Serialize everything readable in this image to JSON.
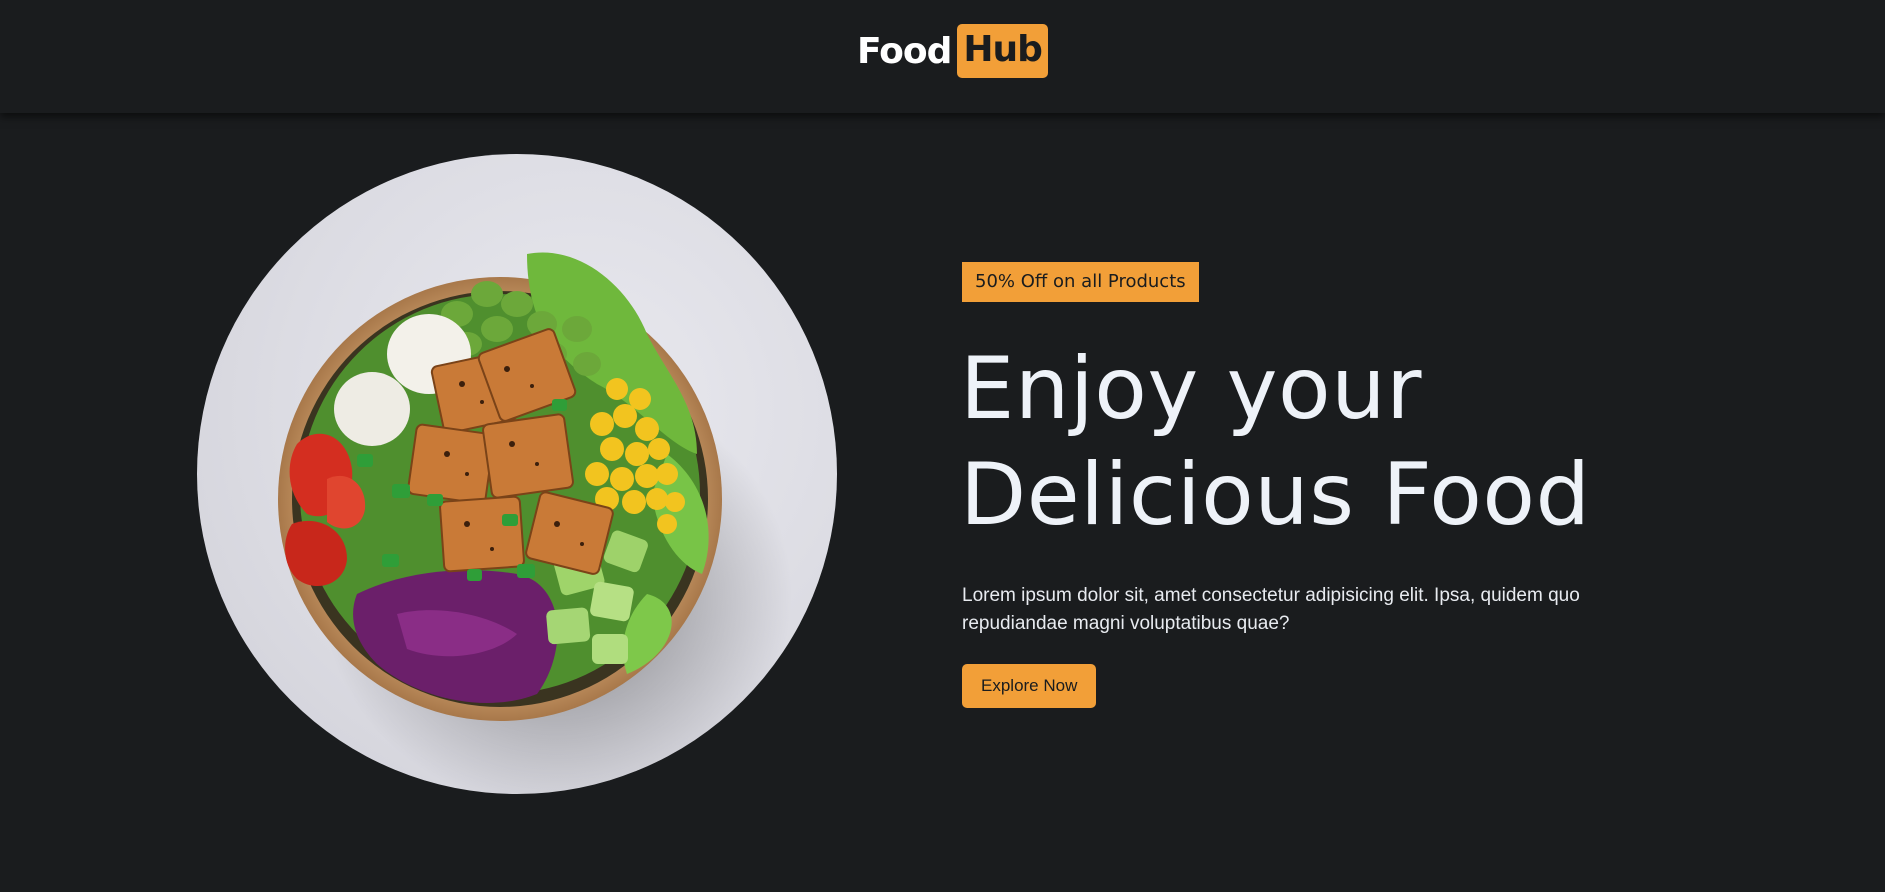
{
  "header": {
    "logo": {
      "part1": "Food",
      "part2": "Hub"
    }
  },
  "hero": {
    "image_alt": "Salad bowl with tofu, egg, corn, edamame, tomato, cucumber and red cabbage",
    "badge": "50% Off on all Products",
    "title_line1": "Enjoy your",
    "title_line2": "Delicious Food",
    "description": "Lorem ipsum dolor sit, amet consectetur adipisicing elit. Ipsa, quidem quo repudiandae magni voluptatibus quae?",
    "cta_label": "Explore Now"
  },
  "colors": {
    "background": "#1a1c1e",
    "accent": "#f29f38",
    "text": "#eef2f8"
  }
}
